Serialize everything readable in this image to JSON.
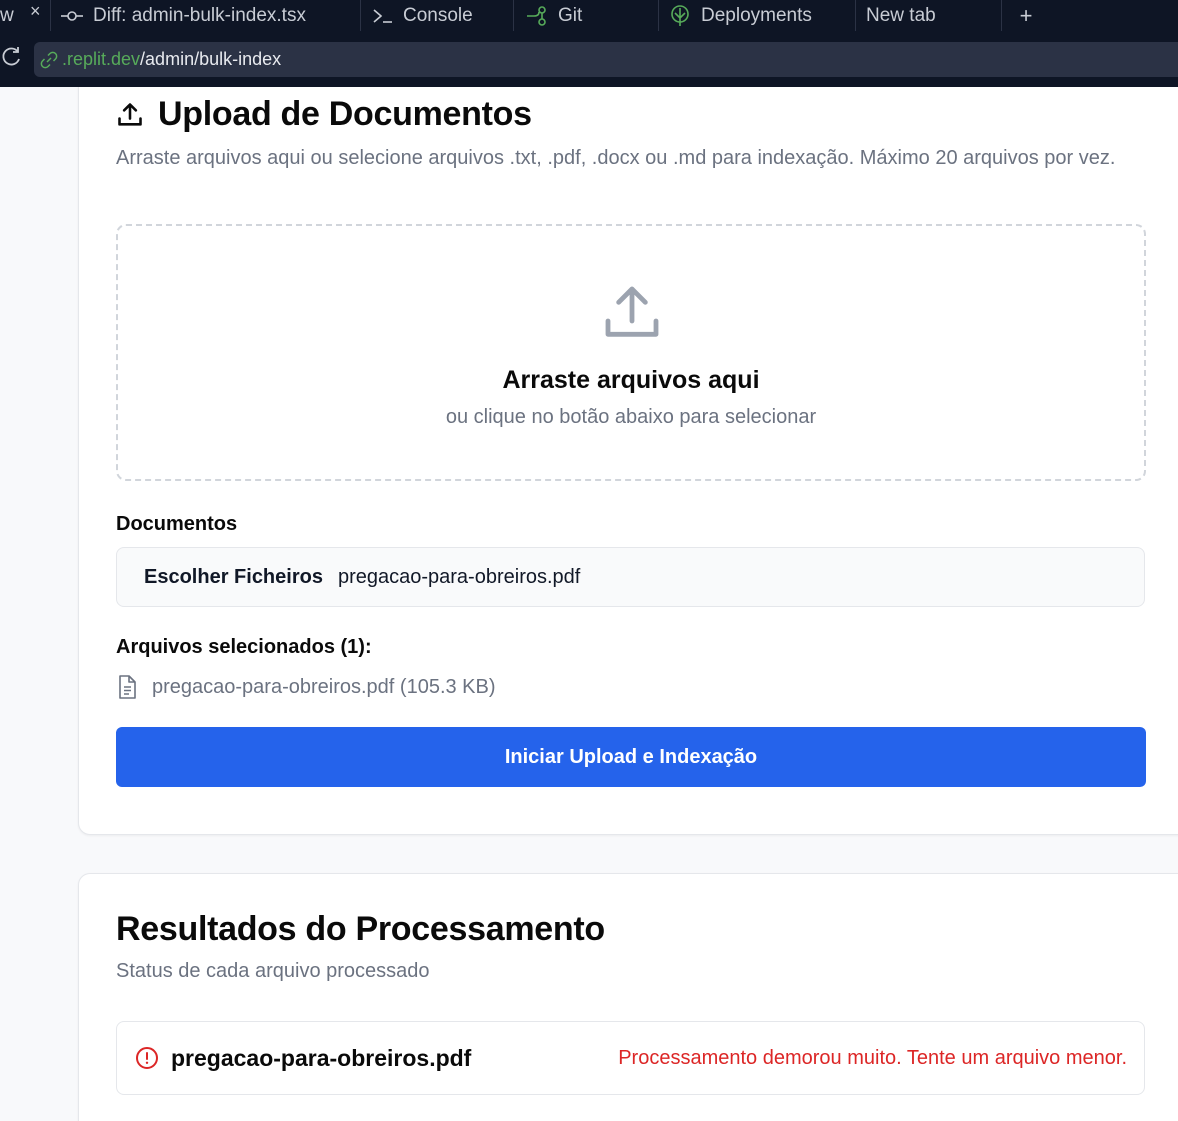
{
  "browser": {
    "tabs": [
      {
        "label": "w",
        "icon": "close-icon"
      },
      {
        "label": "Diff: admin-bulk-index.tsx",
        "icon": "commit-icon"
      },
      {
        "label": "Console",
        "icon": "terminal-icon"
      },
      {
        "label": "Git",
        "icon": "git-branch-icon"
      },
      {
        "label": "Deployments",
        "icon": "deploy-icon"
      },
      {
        "label": "New tab",
        "icon": ""
      }
    ],
    "new_tab_symbol": "+",
    "close_symbol": "×",
    "url": {
      "domain": ".replit.dev",
      "path": "/admin/bulk-index"
    }
  },
  "upload": {
    "title": "Upload de Documentos",
    "description": "Arraste arquivos aqui ou selecione arquivos .txt, .pdf, .docx ou .md para indexação. Máximo 20 arquivos por vez.",
    "dropzone_title": "Arraste arquivos aqui",
    "dropzone_subtitle": "ou clique no botão abaixo para selecionar",
    "documents_label": "Documentos",
    "file_button": "Escolher Ficheiros",
    "file_chosen": "pregacao-para-obreiros.pdf",
    "selected_label": "Arquivos selecionados (1):",
    "selected_files": [
      {
        "text": "pregacao-para-obreiros.pdf (105.3 KB)"
      }
    ],
    "submit_label": "Iniciar Upload e Indexação"
  },
  "results": {
    "title": "Resultados do Processamento",
    "subtitle": "Status de cada arquivo processado",
    "items": [
      {
        "name": "pregacao-para-obreiros.pdf",
        "message": "Processamento demorou muito. Tente um arquivo menor.",
        "status": "error"
      }
    ]
  },
  "colors": {
    "accent": "#2563eb",
    "error": "#dc2626",
    "chrome": "#0e1525"
  }
}
